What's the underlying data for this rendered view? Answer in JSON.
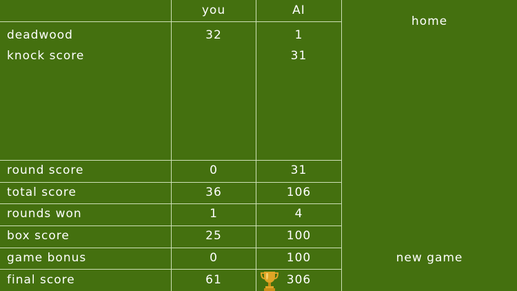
{
  "header": {
    "you": "you",
    "ai": "AI"
  },
  "rows": [
    {
      "label": "deadwood",
      "you": "32",
      "ai": "1"
    },
    {
      "label": "knock score",
      "you": "",
      "ai": "31"
    },
    {
      "label": "round score",
      "you": "0",
      "ai": "31"
    },
    {
      "label": "total score",
      "you": "36",
      "ai": "106"
    },
    {
      "label": "rounds won",
      "you": "1",
      "ai": "4"
    },
    {
      "label": "box score",
      "you": "25",
      "ai": "100"
    },
    {
      "label": "game bonus",
      "you": "0",
      "ai": "100"
    },
    {
      "label": "final score",
      "you": "61",
      "ai": "306"
    }
  ],
  "actions": {
    "home": "home",
    "new_game": "new game"
  },
  "winner_icon": "trophy-icon",
  "colors": {
    "background": "#44700f",
    "grid": "#cfe0b8",
    "trophy": "#e0a526"
  }
}
